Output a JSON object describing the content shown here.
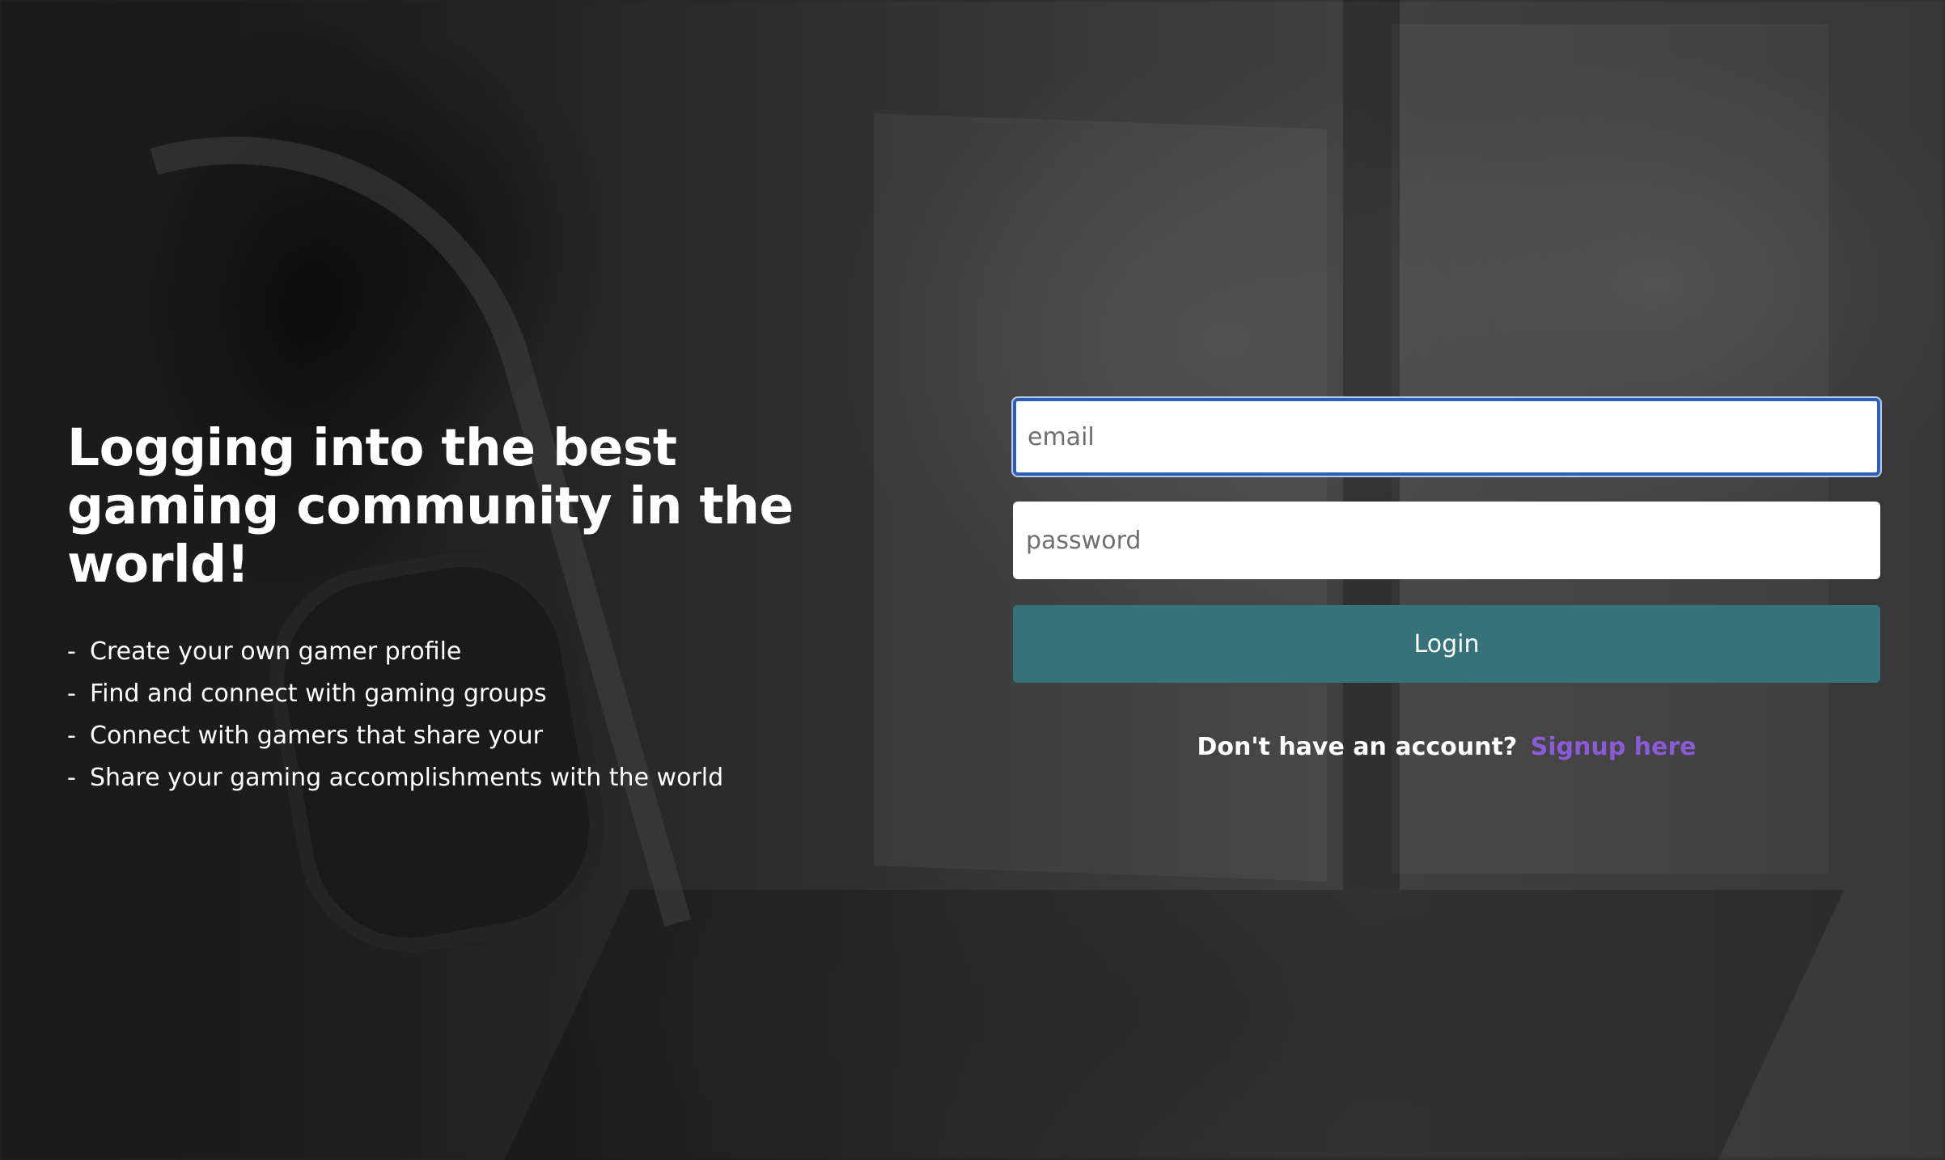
{
  "hero": {
    "headline": "Logging into the best gaming community in the world!",
    "features": [
      "Create your own gamer profile",
      "Find and connect with gaming groups",
      "Connect with gamers that share your",
      "Share your gaming accomplishments with the world"
    ],
    "bullet": "-"
  },
  "login_form": {
    "email": {
      "placeholder": "email",
      "value": "",
      "focused": true
    },
    "password": {
      "placeholder": "password",
      "value": ""
    },
    "login_label": "Login",
    "signup_prompt": "Don't have an account?",
    "signup_link": "Signup here"
  },
  "colors": {
    "accent_button": "#357279",
    "link": "#8b5ad6",
    "focus_ring": "#2b5fb8"
  }
}
